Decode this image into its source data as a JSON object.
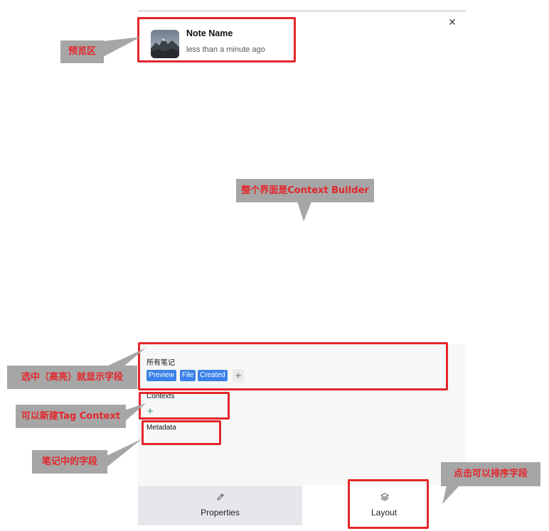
{
  "preview": {
    "note_name": "Note Name",
    "note_time": "less than a minute ago",
    "thumbnail": "mountain-landscape-thumbnail"
  },
  "close_icon": "close-icon",
  "sections": {
    "all_notes_label": "所有笔记",
    "chips": [
      "Preview",
      "File",
      "Created"
    ],
    "add_symbol": "+",
    "contexts_label": "Contexts",
    "contexts_add": "+",
    "metadata_label": "Metadata"
  },
  "tabs": {
    "properties": {
      "label": "Properties",
      "icon": "pencil-icon"
    },
    "layout": {
      "label": "Layout",
      "icon": "layers-icon"
    }
  },
  "annotations": {
    "preview_area": "预览区",
    "whole_interface": "整个界面是Context  Builder",
    "select_highlight": "选中（高亮）就显示字段",
    "new_tag_context": "可以新建Tag Context",
    "note_fields": "笔记中的字段",
    "click_sort": "点击可以排序字段"
  },
  "colors": {
    "highlight_red": "#e4262b",
    "callout_gray": "#a6a6a6",
    "chip_blue": "#3b82e8",
    "active_tab_bg": "#e5e7ea"
  }
}
